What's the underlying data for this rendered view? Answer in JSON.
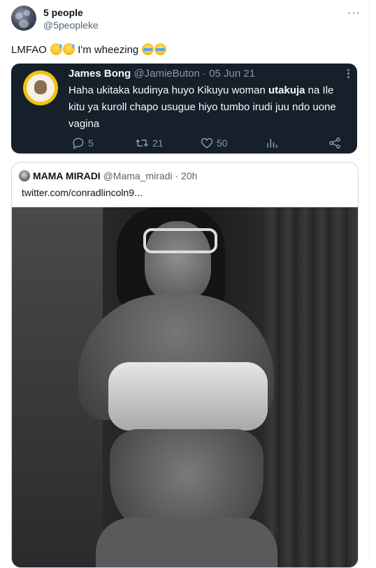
{
  "author": {
    "name": "5 people",
    "handle": "@5peopleke"
  },
  "tweet": {
    "text_start": "LMFAO",
    "text_mid": "I'm wheezing"
  },
  "quoted": {
    "name": "James Bong",
    "handle": "@JamieButon",
    "sep": "·",
    "date": "05 Jun 21",
    "body_pre": "Haha ukitaka kudinya huyo Kikuyu woman ",
    "body_bold": "utakuja",
    "body_post": " na Ile kitu ya kuroll chapo usugue hiyo tumbo irudi juu ndo uone vagina",
    "replies": "5",
    "retweets": "21",
    "likes": "50"
  },
  "retweeted": {
    "name": "MAMA MIRADI",
    "handle": "@Mama_miradi",
    "sep": "·",
    "time": "20h",
    "link": "twitter.com/conradlincoln9..."
  },
  "icons": {
    "more": "more-horizontal-icon",
    "reply": "reply-icon",
    "retweet": "retweet-icon",
    "like": "heart-icon",
    "views": "views-icon",
    "share": "share-icon"
  },
  "colors": {
    "dark_card": "#15202b",
    "muted": "#8b98a5",
    "handle_gray": "#536471"
  }
}
